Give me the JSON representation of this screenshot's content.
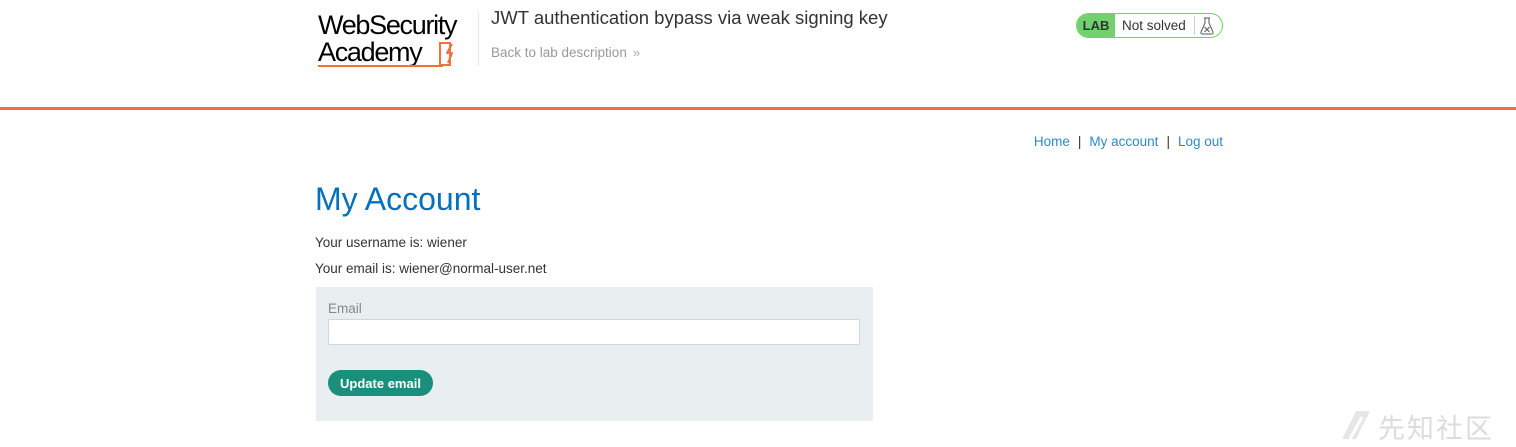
{
  "header": {
    "logo": {
      "line1": "WebSecurity",
      "line2": "Academy"
    },
    "lab_title": "JWT authentication bypass via weak signing key",
    "back_link": "Back to lab description",
    "back_chevron": "»",
    "lab_status": {
      "badge": "LAB",
      "status": "Not solved",
      "icon": "flask-icon"
    }
  },
  "nav": {
    "home": "Home",
    "my_account": "My account",
    "log_out": "Log out",
    "separator": "|"
  },
  "main": {
    "title": "My Account",
    "username_line": "Your username is: wiener",
    "email_line": "Your email is: wiener@normal-user.net",
    "form": {
      "email_label": "Email",
      "email_value": "",
      "submit_label": "Update email"
    }
  },
  "watermark": {
    "text": "先知社区"
  },
  "colors": {
    "accent_orange": "#f26f3e",
    "title_blue": "#0071bc",
    "link_blue": "#2a8bc6",
    "lab_green": "#70d16d",
    "button_teal": "#198f7c",
    "panel_bg": "#e9eef1"
  }
}
